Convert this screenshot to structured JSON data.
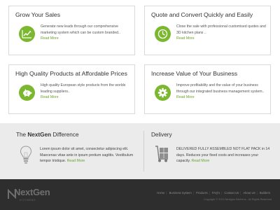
{
  "cards": [
    {
      "title": "Grow Your Sales",
      "icon": "chart-icon",
      "text": "Generate new leads through our comprehensive marketing system which can be custom branded..",
      "link": "Read More"
    },
    {
      "title": "Quote and Convert Quickly and Easily",
      "icon": "clock-icon",
      "text": "Close the sale with professional customised quotes and 3D kitchen plans ..",
      "link": "Read More"
    },
    {
      "title": "High Quality Products at Affordable Prices",
      "icon": "piggy-bank-icon",
      "text": "High quality European style products from the worlds leading suppliers..",
      "link": "Read More"
    },
    {
      "title": "Increase Value of Your Business",
      "icon": "gear-icon",
      "text": "Improve profitability and the value of your business through our integrated business management system..",
      "link": "Read More"
    }
  ],
  "difference": {
    "title_prefix": "The ",
    "title_brand": "NextGen",
    "title_suffix": " Difference",
    "icon": "lightbulb-icon",
    "text": "Lorem ipsum dolor sit amet, consectetur adipiscing elit. Maecenas vitae ante in ipsum pretium sagittis. Vestibulum tempor tristique.",
    "link": "Read More"
  },
  "delivery": {
    "title": "Delivery",
    "icon": "hand-truck-icon",
    "text": "DELIVERED FULLY ASSEMBLED NOT FLAT PACK in 14 days. Reduces your fixed costs and increases your capacity.",
    "link": "Read More"
  },
  "footer": {
    "logo": "NextGen",
    "logo_sub": "KITCHENS",
    "nav": [
      "Home",
      "Business System",
      "Products",
      "FAQ's",
      "Contact Us",
      "About Us",
      "Builders"
    ],
    "copyright": "Copyright © 2013 Nextgen Kitchens - All Rights Reserved"
  },
  "colors": {
    "accent": "#7cb82f",
    "link": "#6aa22c",
    "footer_bg": "#2e2e2e",
    "section_bg": "#ebebeb"
  }
}
